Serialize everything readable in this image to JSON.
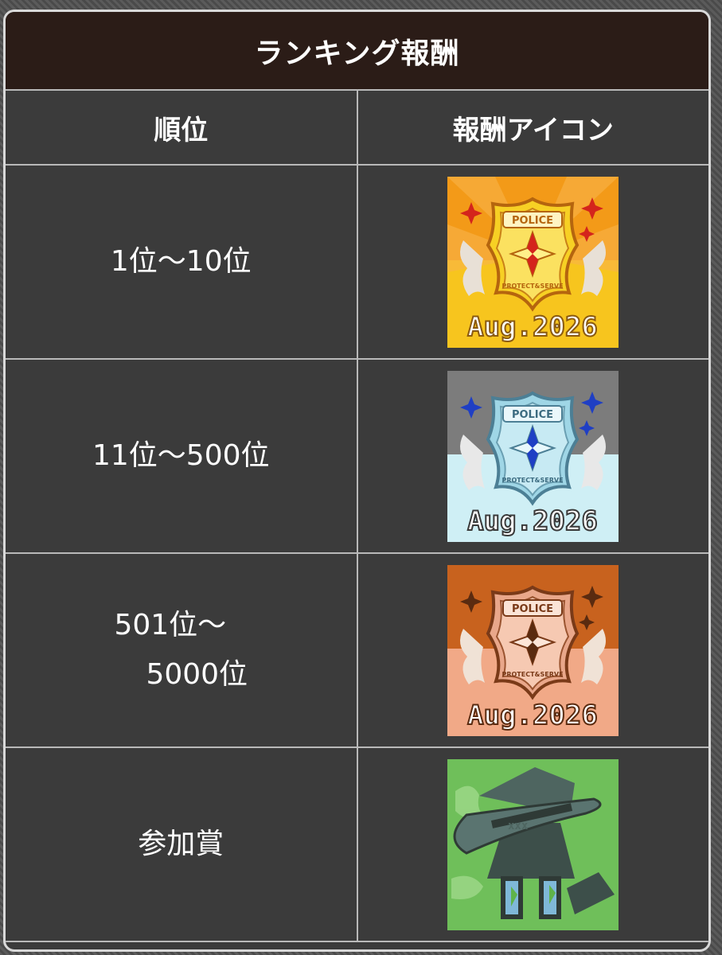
{
  "title": "ランキング報酬",
  "headers": {
    "rank": "順位",
    "icon": "報酬アイコン"
  },
  "rows": [
    {
      "rank": "1位〜10位",
      "tier": "gold"
    },
    {
      "rank": "11位〜500位",
      "tier": "silver"
    },
    {
      "rank_line1": "501位〜",
      "rank_line2": "5000位",
      "tier": "bronze"
    },
    {
      "rank": "参加賞",
      "tier": "participation"
    }
  ],
  "badge": {
    "police": "POLICE",
    "motto": "PROTECT&SERVE",
    "date": "Aug.2026"
  },
  "icons": [
    "police-badge-gold-icon",
    "police-badge-silver-icon",
    "police-badge-bronze-icon",
    "detective-hat-icon"
  ],
  "colors": {
    "title_bg": "#2b1c17",
    "panel_bg": "#3b3b3b",
    "gold": "#f39a18",
    "silver": "#7c7c7c",
    "bronze": "#c8621e",
    "participation": "#6fbf5a"
  }
}
